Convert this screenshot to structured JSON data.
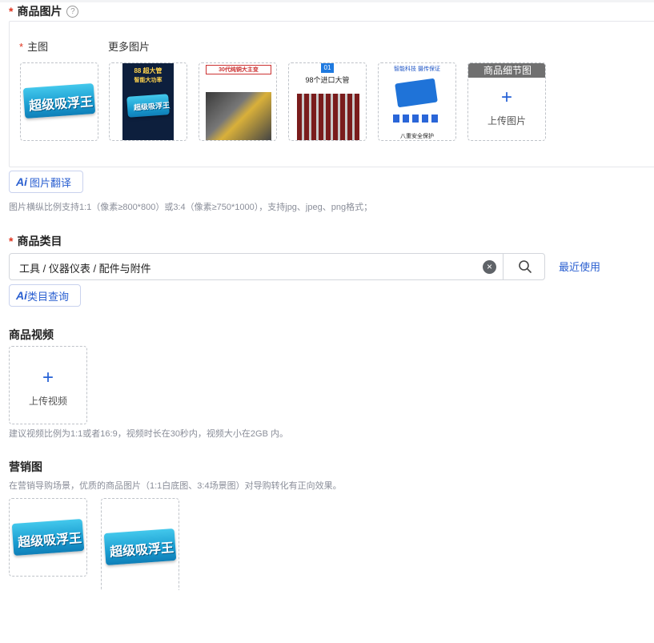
{
  "product_images": {
    "required_mark": "*",
    "label": "商品图片",
    "help_icon": "?",
    "main_label": "主图",
    "more_label": "更多图片",
    "main_image_text": "超级吸浮王",
    "more_images": [
      {
        "top_text": "88 超大管",
        "sub_text": "智能大功率",
        "body_text": "超级吸浮王"
      },
      {
        "top_text": "30代纯铜大主变"
      },
      {
        "badge": "01",
        "top_text": "98个进口大管"
      },
      {
        "top_text": "智能科技 摄传保证",
        "bottom_text": "八重安全保护"
      }
    ],
    "detail_tag": "商品细节图",
    "upload_plus": "+",
    "upload_label": "上传图片",
    "ai_translate": "图片翻译",
    "hint": "图片横纵比例支持1:1（像素≥800*800）或3:4（像素≥750*1000），支持jpg、jpeg、png格式；"
  },
  "category": {
    "required_mark": "*",
    "label": "商品类目",
    "value": "工具 / 仪器仪表 / 配件与附件",
    "clear": "×",
    "recent": "最近使用",
    "ai_query": "类目查询"
  },
  "video": {
    "label": "商品视频",
    "upload_plus": "+",
    "upload_label": "上传视频",
    "hint": "建议视频比例为1:1或者16:9，视频时长在30秒内，视频大小在2GB 内。"
  },
  "marketing": {
    "label": "营销图",
    "hint": "在营销导购场景，优质的商品图片（1:1白底图、3:4场景图）对导购转化有正向效果。",
    "images": [
      {
        "text": "超级吸浮王"
      },
      {
        "text": "超级吸浮王"
      }
    ]
  },
  "ai_mark": "Ai",
  "colors": {
    "accent": "#2a5fd0",
    "required": "#e0341f",
    "product_blue": "#1a9cd0"
  }
}
